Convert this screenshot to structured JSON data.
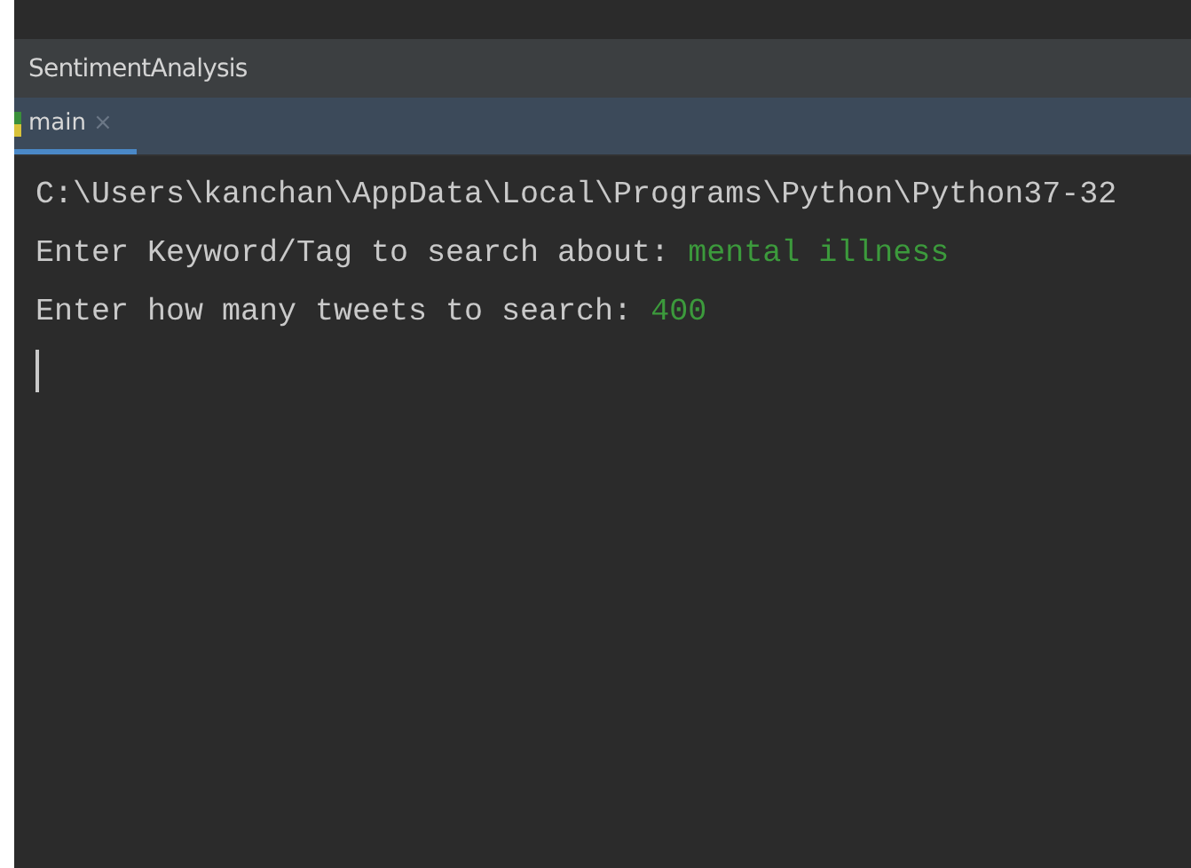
{
  "window": {
    "title": "SentimentAnalysis"
  },
  "tabs": [
    {
      "label": "main",
      "selected": true,
      "close": "×"
    }
  ],
  "console": {
    "lines": [
      {
        "kind": "output",
        "text": "C:\\Users\\kanchan\\AppData\\Local\\Programs\\Python\\Python37-32"
      },
      {
        "kind": "prompt",
        "text": "Enter Keyword/Tag to search about: ",
        "input": "mental illness"
      },
      {
        "kind": "prompt",
        "text": "Enter how many tweets to search: ",
        "input": "400"
      }
    ]
  }
}
